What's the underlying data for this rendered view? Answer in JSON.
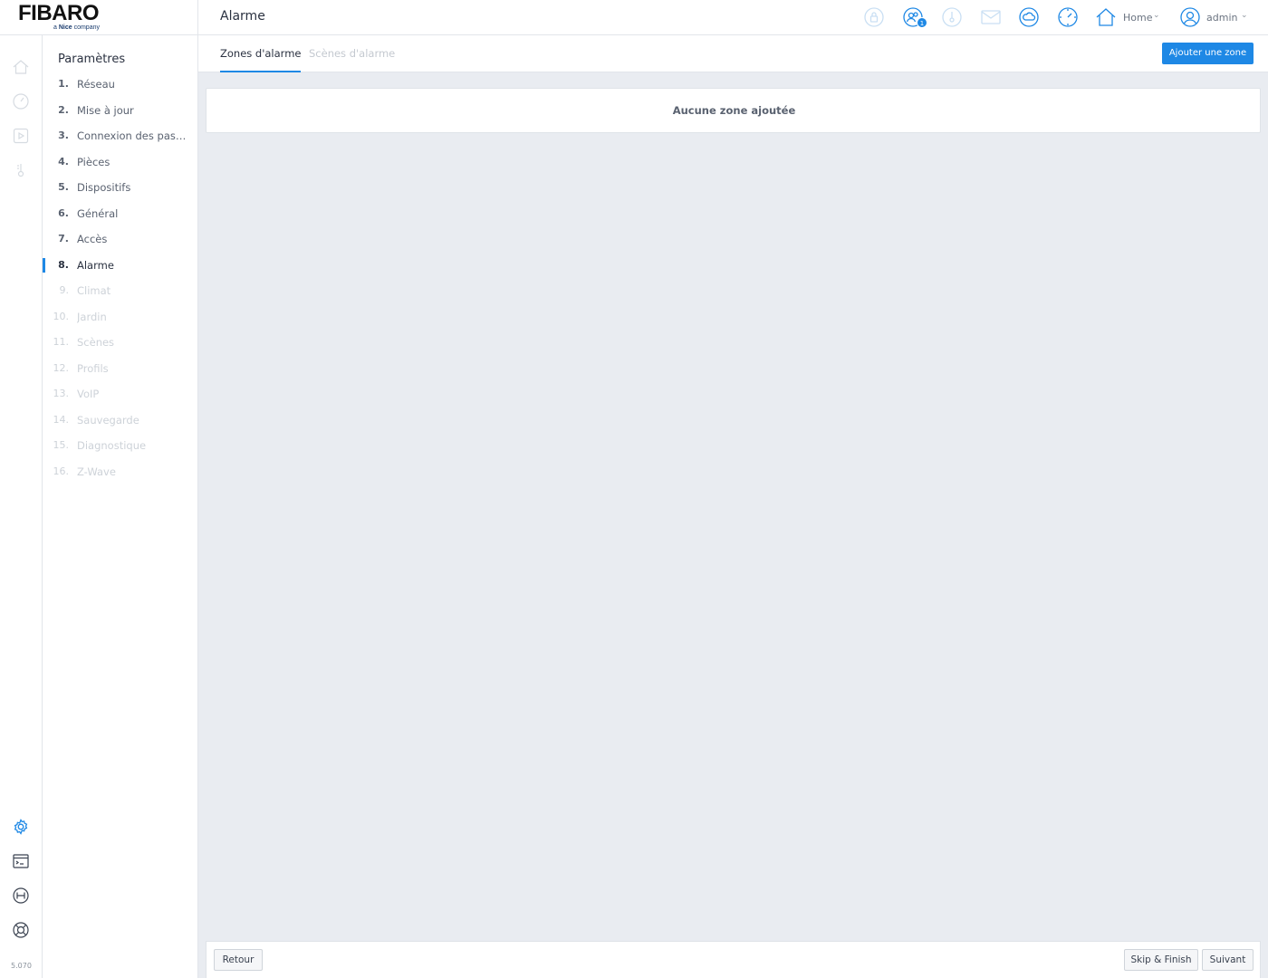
{
  "brand": {
    "name": "FIBARO",
    "tagline_prefix": "a ",
    "tagline_brand": "Nice",
    "tagline_suffix": " company"
  },
  "header": {
    "title": "Alarme",
    "notification_badge": "1",
    "home_label": "Home",
    "user_label": "admin"
  },
  "sidebar": {
    "title": "Paramètres",
    "steps": [
      {
        "num": "1.",
        "label": "Réseau"
      },
      {
        "num": "2.",
        "label": "Mise à jour"
      },
      {
        "num": "3.",
        "label": "Connexion des passe..."
      },
      {
        "num": "4.",
        "label": "Pièces"
      },
      {
        "num": "5.",
        "label": "Dispositifs"
      },
      {
        "num": "6.",
        "label": "Général"
      },
      {
        "num": "7.",
        "label": "Accès"
      },
      {
        "num": "8.",
        "label": "Alarme"
      },
      {
        "num": "9.",
        "label": "Climat"
      },
      {
        "num": "10.",
        "label": "Jardin"
      },
      {
        "num": "11.",
        "label": "Scènes"
      },
      {
        "num": "12.",
        "label": "Profils"
      },
      {
        "num": "13.",
        "label": "VoIP"
      },
      {
        "num": "14.",
        "label": "Sauvegarde"
      },
      {
        "num": "15.",
        "label": "Diagnostique"
      },
      {
        "num": "16.",
        "label": "Z-Wave"
      }
    ]
  },
  "main": {
    "tabs": [
      {
        "label": "Zones d'alarme"
      },
      {
        "label": "Scènes d'alarme"
      }
    ],
    "add_button": "Ajouter une zone",
    "empty_message": "Aucune zone ajoutée"
  },
  "footer": {
    "back": "Retour",
    "skip": "Skip & Finish",
    "next": "Suivant"
  },
  "version": "5.070",
  "colors": {
    "accent": "#1e88e5",
    "background": "#e9ecf1"
  }
}
